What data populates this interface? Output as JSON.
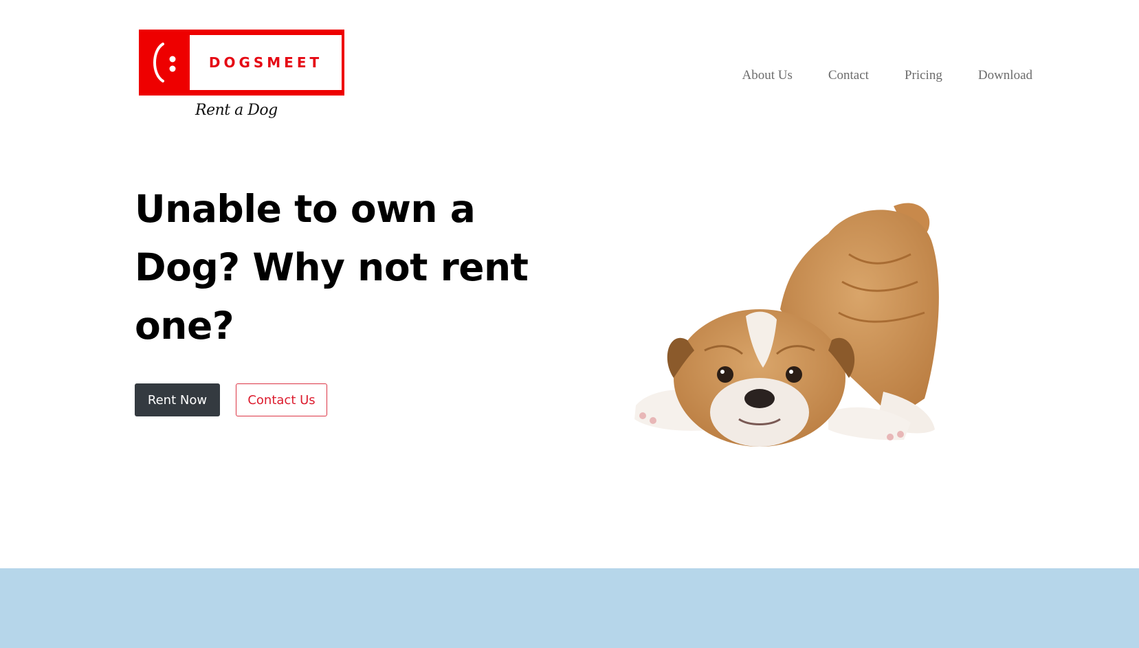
{
  "brand": {
    "logo_text": "DOGSMEET",
    "tagline": "Rent a Dog",
    "colors": {
      "primary": "#ee0000",
      "dark_button": "#343a40",
      "outline_button": "#dc3545",
      "band": "#b6d6ea"
    }
  },
  "nav": {
    "items": [
      {
        "label": "About Us"
      },
      {
        "label": "Contact"
      },
      {
        "label": "Pricing"
      },
      {
        "label": "Download"
      }
    ]
  },
  "hero": {
    "title": "Unable to own a Dog? Why not rent one?",
    "primary_button": "Rent Now",
    "secondary_button": "Contact Us",
    "image_icon": "bulldog-puppy-illustration"
  }
}
